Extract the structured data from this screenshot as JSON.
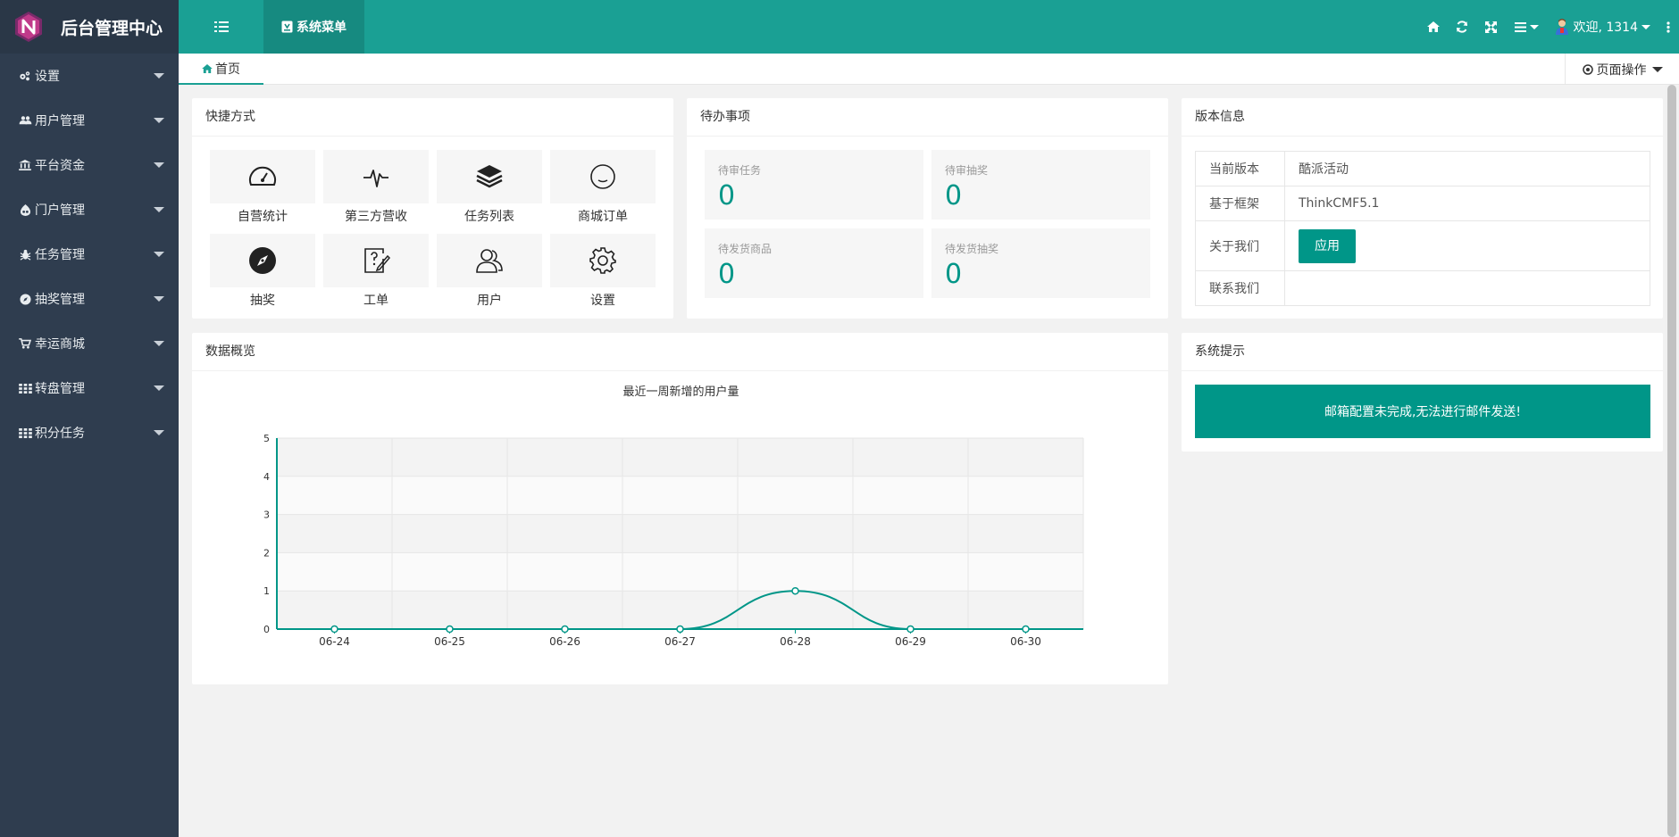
{
  "app": {
    "title": "后台管理中心"
  },
  "sidebar": {
    "items": [
      {
        "label": "设置",
        "icon": "gears-icon"
      },
      {
        "label": "用户管理",
        "icon": "users-icon"
      },
      {
        "label": "平台资金",
        "icon": "bank-icon"
      },
      {
        "label": "门户管理",
        "icon": "drupal-icon"
      },
      {
        "label": "任务管理",
        "icon": "bug-icon"
      },
      {
        "label": "抽奖管理",
        "icon": "compass-icon"
      },
      {
        "label": "幸运商城",
        "icon": "shopping-icon"
      },
      {
        "label": "转盘管理",
        "icon": "grid-icon"
      },
      {
        "label": "积分任务",
        "icon": "grid-icon"
      }
    ]
  },
  "header": {
    "system_menu_label": "系统菜单",
    "welcome_label": "欢迎, 1314"
  },
  "tabs": {
    "home_label": "首页",
    "page_ops_label": "页面操作"
  },
  "shortcuts": {
    "title": "快捷方式",
    "items": [
      {
        "label": "自营统计",
        "icon": "dashboard-icon"
      },
      {
        "label": "第三方营收",
        "icon": "pulse-icon"
      },
      {
        "label": "任务列表",
        "icon": "layers-icon"
      },
      {
        "label": "商城订单",
        "icon": "smile-icon"
      },
      {
        "label": "抽奖",
        "icon": "compass-icon"
      },
      {
        "label": "工单",
        "icon": "help-doc-icon"
      },
      {
        "label": "用户",
        "icon": "users-icon"
      },
      {
        "label": "设置",
        "icon": "gear-icon"
      }
    ]
  },
  "todo": {
    "title": "待办事项",
    "items": [
      {
        "label": "待审任务",
        "value": "0"
      },
      {
        "label": "待审抽奖",
        "value": "0"
      },
      {
        "label": "待发货商品",
        "value": "0"
      },
      {
        "label": "待发货抽奖",
        "value": "0"
      }
    ]
  },
  "version": {
    "title": "版本信息",
    "rows": [
      {
        "label": "当前版本",
        "value": "酷派活动"
      },
      {
        "label": "基于框架",
        "value": "ThinkCMF5.1"
      },
      {
        "label": "关于我们",
        "button": "应用"
      },
      {
        "label": "联系我们",
        "value": ""
      }
    ]
  },
  "overview": {
    "title": "数据概览"
  },
  "system_tip": {
    "title": "系统提示",
    "message": "邮箱配置未完成,无法进行邮件发送!"
  },
  "colors": {
    "accent": "#009688",
    "header": "#1aa094",
    "sidebar": "#2f3d4f"
  },
  "chart_data": {
    "type": "line",
    "title": "最近一周新增的用户量",
    "categories": [
      "06-24",
      "06-25",
      "06-26",
      "06-27",
      "06-28",
      "06-29",
      "06-30"
    ],
    "values": [
      0,
      0,
      0,
      0,
      1,
      0,
      0
    ],
    "ylim": [
      0,
      5
    ],
    "yticks": [
      0,
      1,
      2,
      3,
      4,
      5
    ],
    "grid": true,
    "smooth": true
  }
}
